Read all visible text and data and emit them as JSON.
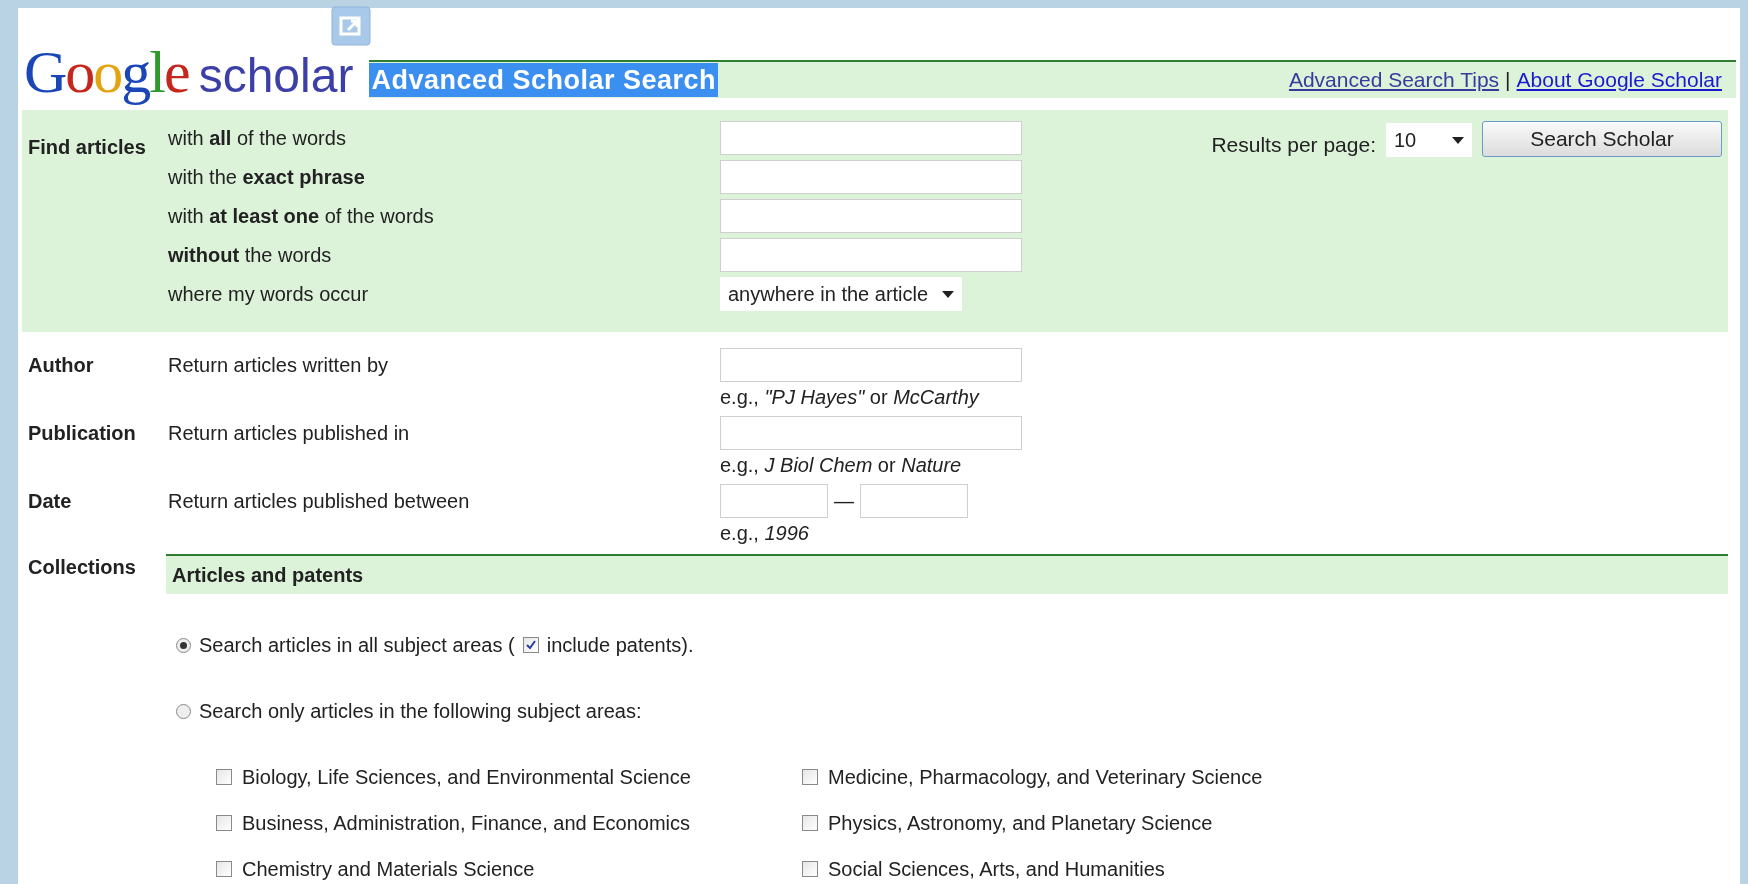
{
  "logo": {
    "brand": "Google",
    "product": "scholar"
  },
  "page_title": "Advanced Scholar Search",
  "header_links": [
    "Advanced Search Tips",
    "About Google Scholar"
  ],
  "link_separator": "|",
  "find": {
    "heading": "Find articles",
    "rows": [
      {
        "label": "with **all** of the words",
        "kind": "text"
      },
      {
        "label": "with the **exact phrase**",
        "kind": "text"
      },
      {
        "label": "with **at least one** of the words",
        "kind": "text"
      },
      {
        "label": "**without** the words",
        "kind": "text"
      },
      {
        "label": "where my words occur",
        "kind": "select",
        "value": "anywhere in the article"
      }
    ]
  },
  "results_per_page": {
    "label": "Results per page:",
    "value": "10"
  },
  "search_button": "Search Scholar",
  "fields": [
    {
      "heading": "Author",
      "label": "Return articles written by",
      "kind": "text",
      "hint": "e.g., *\"PJ Hayes\"* or *McCarthy*"
    },
    {
      "heading": "Publication",
      "label": "Return articles published in",
      "kind": "text",
      "hint": "e.g., *J Biol Chem* or *Nature*"
    },
    {
      "heading": "Date",
      "label": "Return articles published between",
      "kind": "range",
      "separator": "—",
      "hint": "e.g., *1996*"
    }
  ],
  "collections": {
    "heading": "Collections",
    "section_title": "Articles and patents",
    "options": [
      {
        "label": "Search articles in all subject areas (",
        "selected": true,
        "checkbox": {
          "label": "include patents).",
          "checked": true
        }
      },
      {
        "label": "Search only articles in the following subject areas:",
        "selected": false
      }
    ],
    "subjects": [
      {
        "label": "Biology, Life Sciences, and Environmental Science",
        "checked": false
      },
      {
        "label": "Medicine, Pharmacology, and Veterinary Science",
        "checked": false
      },
      {
        "label": "Business, Administration, Finance, and Economics",
        "checked": false
      },
      {
        "label": "Physics, Astronomy, and Planetary Science",
        "checked": false
      },
      {
        "label": "Chemistry and Materials Science",
        "checked": false
      },
      {
        "label": "Social Sciences, Arts, and Humanities",
        "checked": false
      }
    ]
  }
}
